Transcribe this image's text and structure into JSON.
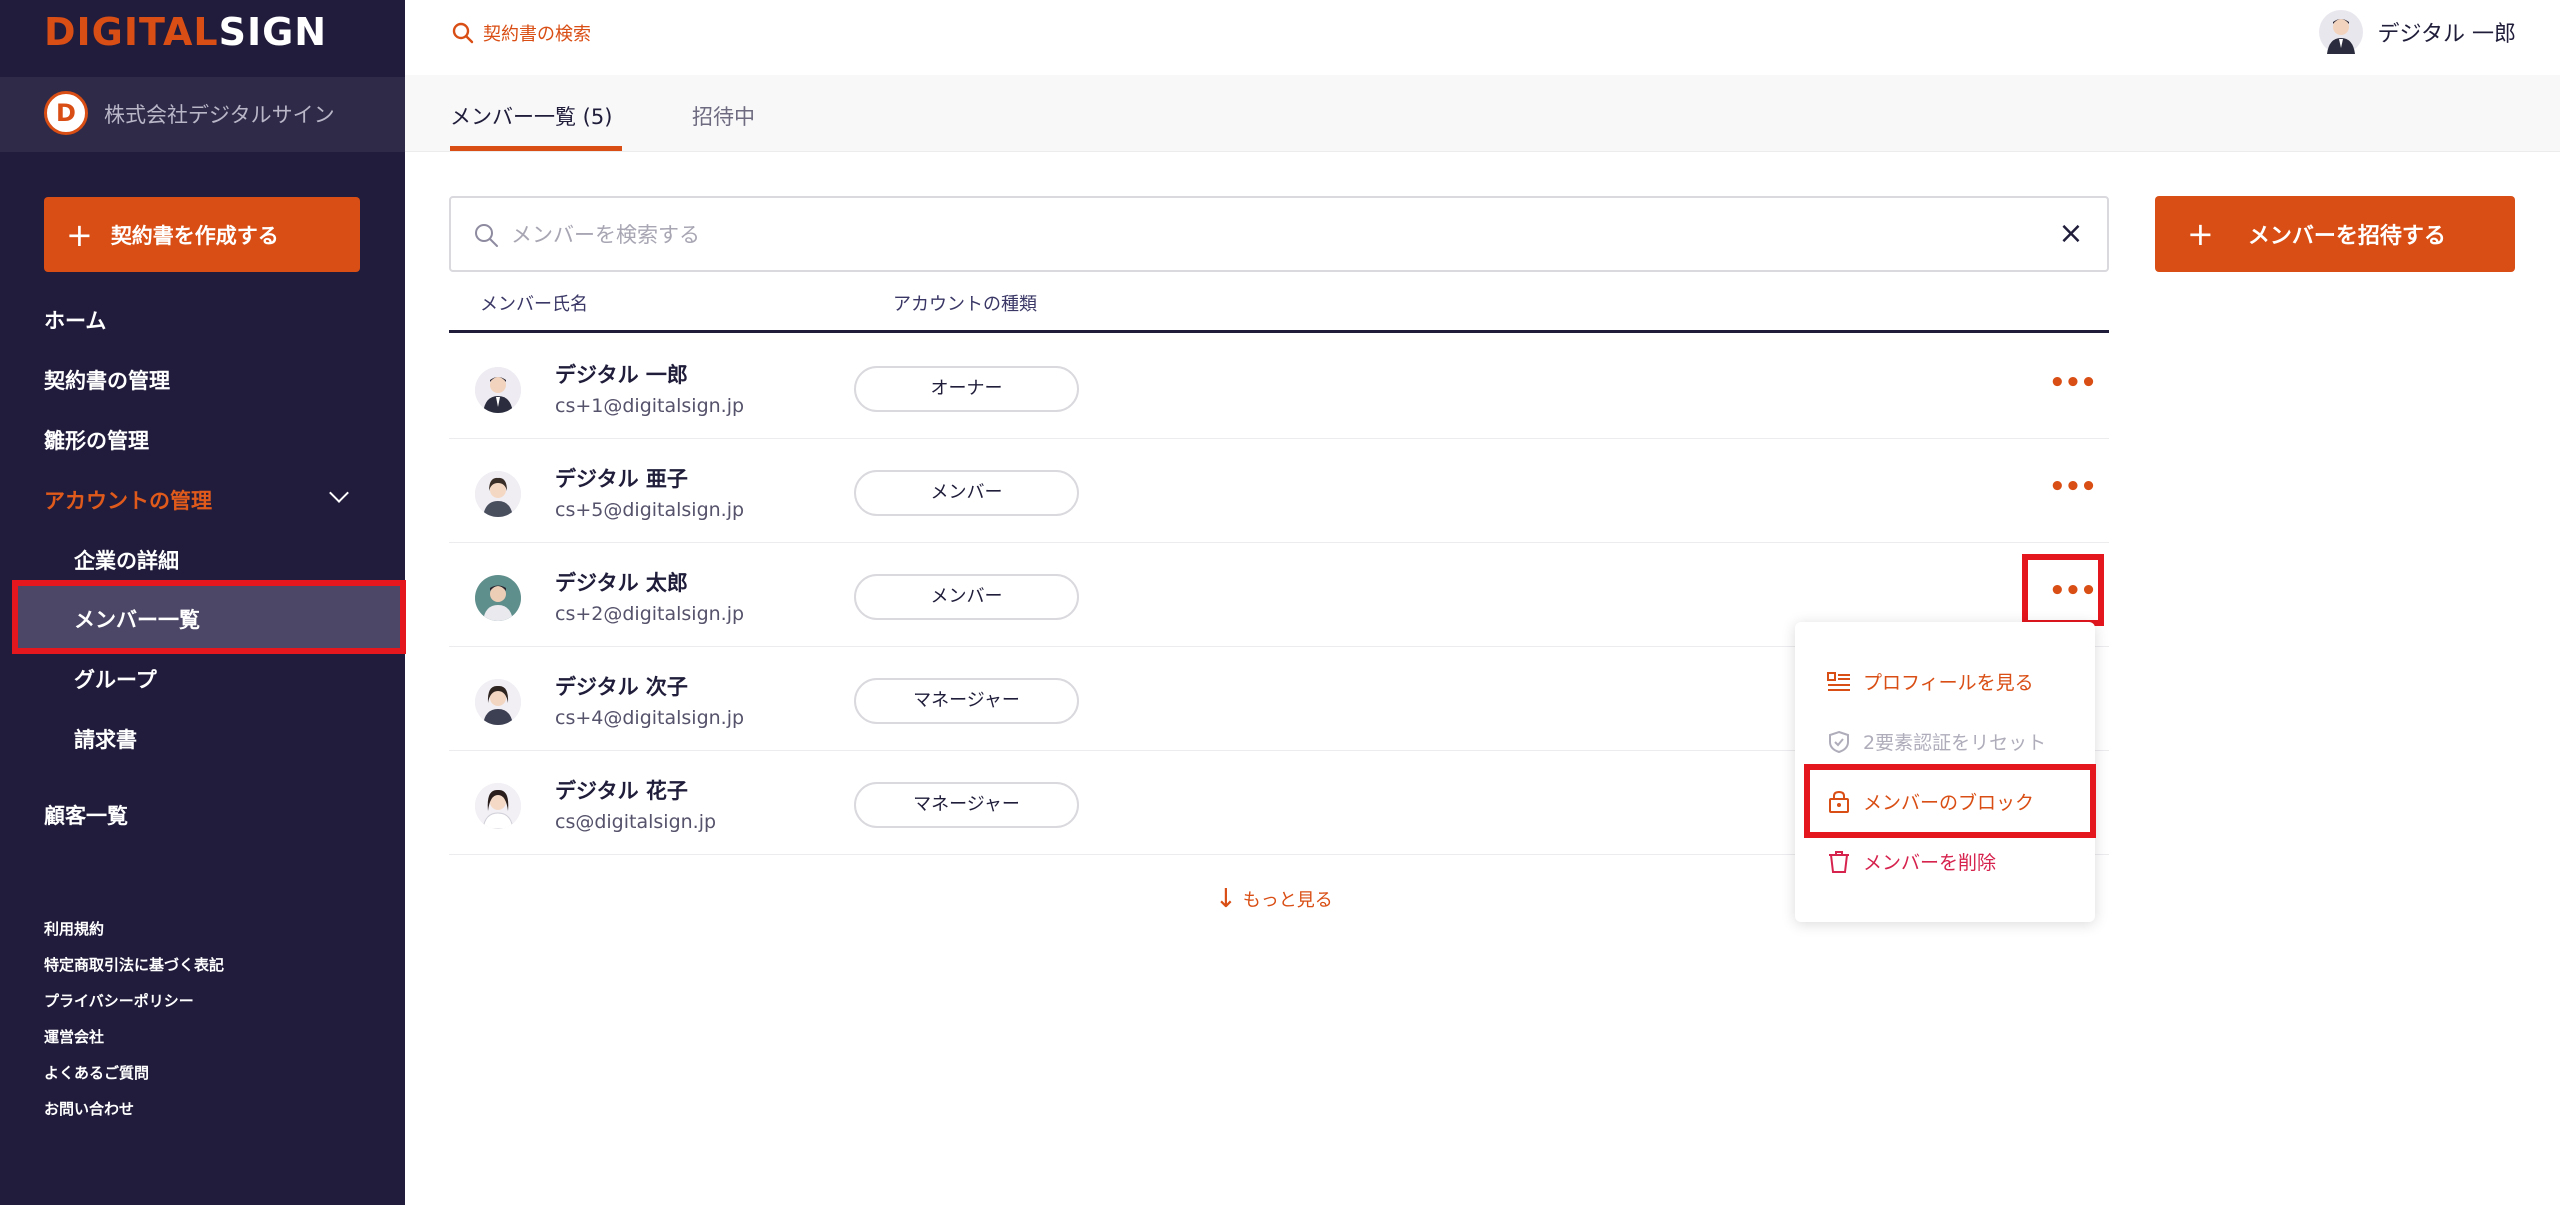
{
  "app": {
    "logo_primary": "DIGITAL",
    "logo_secondary": "SIGN"
  },
  "company": {
    "initial": "D",
    "name": "株式会社デジタルサイン"
  },
  "sidebar": {
    "create_label": "契約書を作成する",
    "nav": [
      {
        "label": "ホーム"
      },
      {
        "label": "契約書の管理"
      },
      {
        "label": "雛形の管理"
      },
      {
        "label": "アカウントの管理"
      }
    ],
    "sub": [
      {
        "label": "企業の詳細"
      },
      {
        "label": "メンバー一覧"
      },
      {
        "label": "グループ"
      },
      {
        "label": "請求書"
      }
    ],
    "customers": "顧客一覧",
    "footer": [
      "利用規約",
      "特定商取引法に基づく表記",
      "プライバシーポリシー",
      "運営会社",
      "よくあるご質問",
      "お問い合わせ"
    ]
  },
  "header": {
    "search_label": "契約書の検索",
    "user_name": "デジタル 一郎"
  },
  "tabs": [
    {
      "label": "メンバー一覧 (5)"
    },
    {
      "label": "招待中"
    }
  ],
  "search": {
    "placeholder": "メンバーを検索する",
    "value": ""
  },
  "invite_label": "メンバーを招待する",
  "table": {
    "headers": [
      "メンバー氏名",
      "アカウントの種類"
    ],
    "rows": [
      {
        "name": "デジタル 一郎",
        "email": "cs+1@digitalsign.jp",
        "role": "オーナー"
      },
      {
        "name": "デジタル 亜子",
        "email": "cs+5@digitalsign.jp",
        "role": "メンバー"
      },
      {
        "name": "デジタル 太郎",
        "email": "cs+2@digitalsign.jp",
        "role": "メンバー"
      },
      {
        "name": "デジタル 次子",
        "email": "cs+4@digitalsign.jp",
        "role": "マネージャー"
      },
      {
        "name": "デジタル 花子",
        "email": "cs@digitalsign.jp",
        "role": "マネージャー"
      }
    ],
    "more_label": "もっと見る"
  },
  "menu": {
    "items": [
      {
        "label": "プロフィールを見る"
      },
      {
        "label": "2要素認証をリセット"
      },
      {
        "label": "メンバーのブロック"
      },
      {
        "label": "メンバーを削除"
      }
    ]
  },
  "colors": {
    "accent": "#d94e14",
    "sidebar_bg": "#211c3b",
    "highlight": "#e4161e"
  }
}
